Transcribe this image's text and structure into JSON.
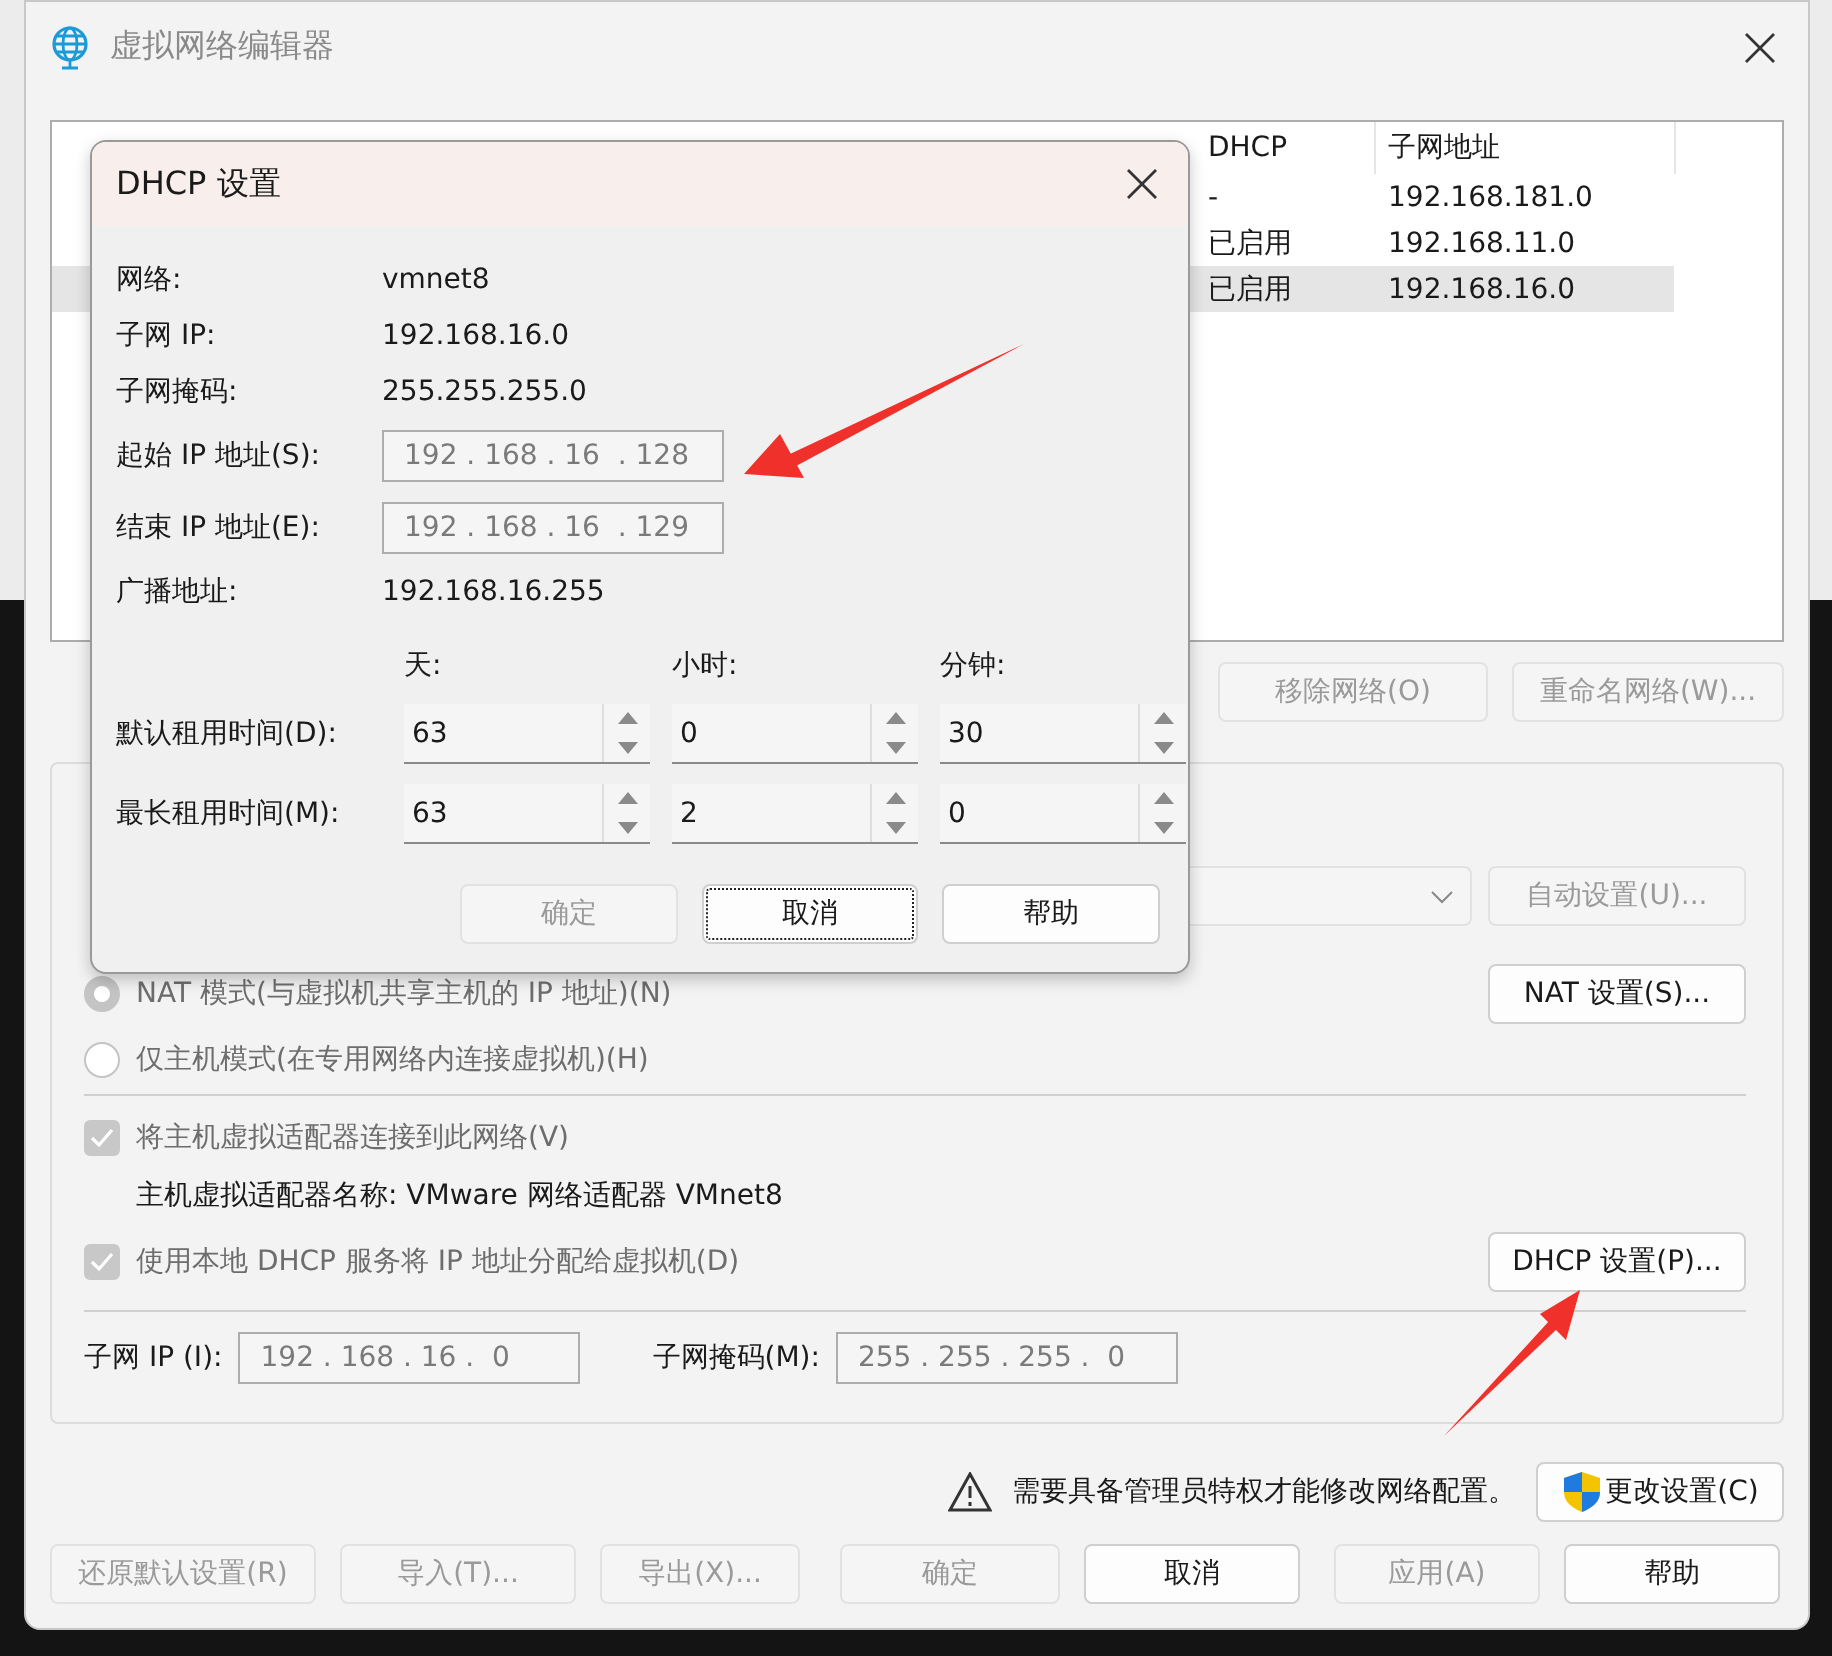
{
  "window": {
    "title": "虚拟网络编辑器"
  },
  "network_table": {
    "columns": [
      "DHCP",
      "子网地址"
    ],
    "rows": [
      {
        "dhcp": "-",
        "subnet": "192.168.181.0",
        "selected": false
      },
      {
        "dhcp": "已启用",
        "subnet": "192.168.11.0",
        "selected": false
      },
      {
        "dhcp": "已启用",
        "subnet": "192.168.16.0",
        "selected": true
      }
    ]
  },
  "network_buttons": [
    {
      "label": "移除网络(O)",
      "disabled": true
    },
    {
      "label": "重命名网络(W)...",
      "disabled": true
    }
  ],
  "vmnet_info": {
    "auto_button": {
      "label": "自动设置(U)...",
      "disabled": true
    },
    "radios": [
      {
        "label": "NAT 模式(与虚拟机共享主机的 IP 地址)(N)",
        "selected": true,
        "button": "NAT 设置(S)..."
      },
      {
        "label": "仅主机模式(在专用网络内连接虚拟机)(H)",
        "selected": false
      }
    ],
    "connect_adapter": {
      "label": "将主机虚拟适配器连接到此网络(V)",
      "checked": true
    },
    "adapter_name": "主机虚拟适配器名称: VMware 网络适配器 VMnet8",
    "dhcp_service": {
      "label": "使用本地 DHCP 服务将 IP 地址分配给虚拟机(D)",
      "checked": true,
      "button": "DHCP 设置(P)..."
    },
    "subnet_ip": {
      "label": "子网 IP (I):",
      "value": "192 . 168 . 16 .  0",
      "disabled": true
    },
    "subnet_mask": {
      "label": "子网掩码(M):",
      "value": "255 . 255 . 255 .  0",
      "disabled": true
    }
  },
  "notice": {
    "text": "需要具备管理员特权才能修改网络配置。",
    "button": "更改设置(C)"
  },
  "footer_buttons": [
    {
      "label": "还原默认设置(R)",
      "disabled": true
    },
    {
      "label": "导入(T)...",
      "disabled": true
    },
    {
      "label": "导出(X)...",
      "disabled": true
    },
    {
      "label": "确定",
      "disabled": true
    },
    {
      "label": "取消",
      "disabled": false
    },
    {
      "label": "应用(A)",
      "disabled": true
    },
    {
      "label": "帮助",
      "disabled": false
    }
  ],
  "dhcp_dialog": {
    "title": "DHCP 设置",
    "rows": [
      {
        "kind": "text",
        "label": "网络:",
        "value": "vmnet8"
      },
      {
        "kind": "text",
        "label": "子网 IP:",
        "value": "192.168.16.0"
      },
      {
        "kind": "text",
        "label": "子网掩码:",
        "value": "255.255.255.0"
      },
      {
        "kind": "field",
        "label": "起始 IP 地址(S):",
        "value": "192 . 168 . 16  . 128",
        "disabled": true
      },
      {
        "kind": "field",
        "label": "结束 IP 地址(E):",
        "value": "192 . 168 . 16  . 129",
        "disabled": true
      },
      {
        "kind": "text",
        "label": "广播地址:",
        "value": "192.168.16.255"
      }
    ],
    "lease": {
      "columns": [
        "天:",
        "小时:",
        "分钟:"
      ],
      "rows": [
        {
          "label": "默认租用时间(D):",
          "values": [
            "63",
            "0",
            "30"
          ]
        },
        {
          "label": "最长租用时间(M):",
          "values": [
            "63",
            "2",
            "0"
          ]
        }
      ]
    },
    "buttons": [
      {
        "label": "确定",
        "disabled": true,
        "focused": false
      },
      {
        "label": "取消",
        "disabled": false,
        "focused": true
      },
      {
        "label": "帮助",
        "disabled": false,
        "focused": false
      }
    ]
  }
}
